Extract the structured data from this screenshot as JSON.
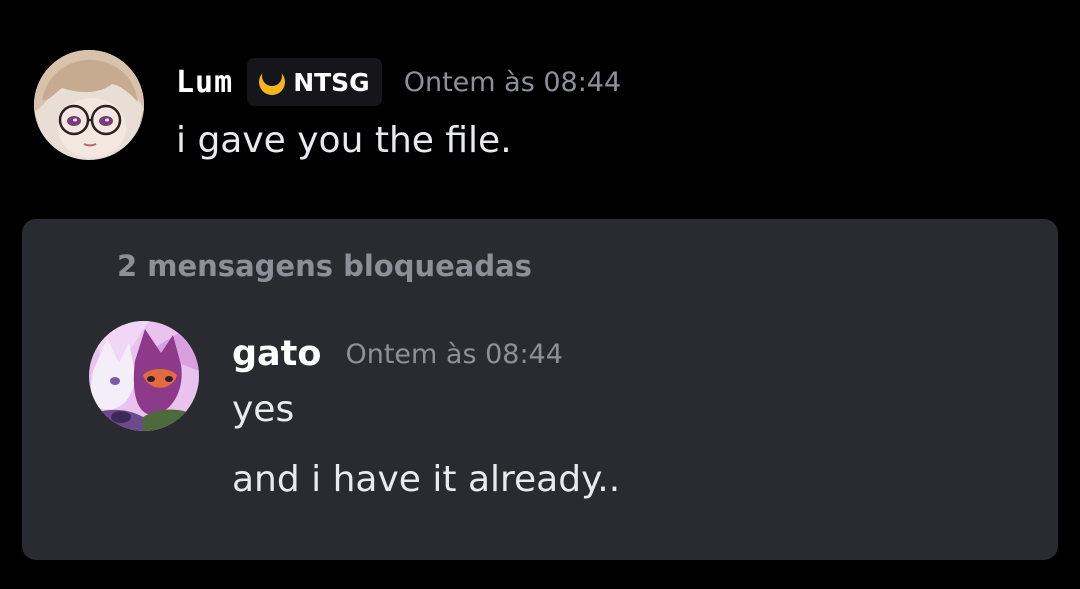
{
  "messages": {
    "first": {
      "username": "Lum",
      "tag": "NTSG",
      "timestamp": "Ontem às 08:44",
      "text": "i gave you the file."
    },
    "blocked_group": {
      "label": "2 mensagens bloqueadas",
      "username": "gato",
      "timestamp": "Ontem às 08:44",
      "lines": [
        "yes",
        "and i have it already.."
      ]
    }
  },
  "icons": {
    "tag_icon": "crescent-moon-icon",
    "lum_avatar": "avatar-glasses-character",
    "gato_avatar": "avatar-cat-character"
  },
  "colors": {
    "background": "#000000",
    "panel": "#2a2b30",
    "timestamp": "#8e9099",
    "tag_icon": "#f5b51d"
  }
}
